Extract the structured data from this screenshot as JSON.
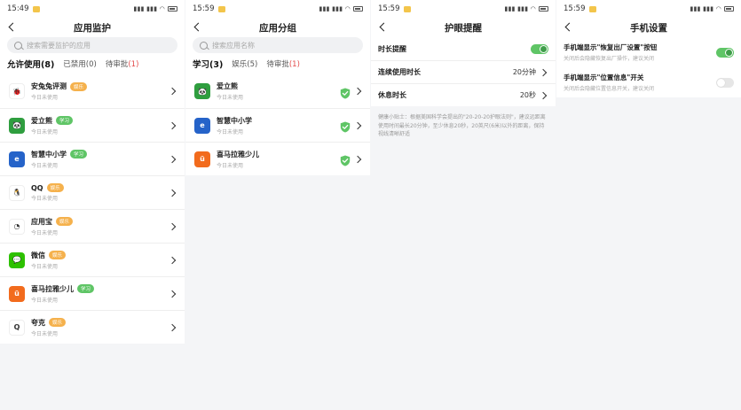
{
  "screens": [
    {
      "status_time": "15:49",
      "title": "应用监护",
      "search_placeholder": "搜索需要监护的应用",
      "tabs": [
        {
          "label": "允许使用(8)",
          "active": true
        },
        {
          "label": "已禁用(0)",
          "active": false
        },
        {
          "label": "待审批",
          "pending": "(1)",
          "active": false
        }
      ],
      "apps": [
        {
          "name": "安兔兔评测",
          "badge": "娱乐",
          "badge_color": "orange",
          "sub": "今日未使用",
          "icon": "antutu-icon",
          "icon_bg": "#ffffff",
          "glyph": "🐞"
        },
        {
          "name": "爱立熊",
          "badge": "学习",
          "badge_color": "green",
          "sub": "今日未使用",
          "icon": "panda-icon",
          "icon_bg": "#2f9e3f",
          "glyph": "🐼"
        },
        {
          "name": "智慧中小学",
          "badge": "学习",
          "badge_color": "green",
          "sub": "今日未使用",
          "icon": "edu-icon",
          "icon_bg": "#2563c9",
          "glyph": "e"
        },
        {
          "name": "QQ",
          "badge": "娱乐",
          "badge_color": "orange",
          "sub": "今日未使用",
          "icon": "qq-icon",
          "icon_bg": "#ffffff",
          "glyph": "🐧"
        },
        {
          "name": "应用宝",
          "badge": "娱乐",
          "badge_color": "orange",
          "sub": "今日未使用",
          "icon": "appstore-icon",
          "icon_bg": "#ffffff",
          "glyph": "◔"
        },
        {
          "name": "微信",
          "badge": "娱乐",
          "badge_color": "orange",
          "sub": "今日未使用",
          "icon": "wechat-icon",
          "icon_bg": "#2dc100",
          "glyph": "💬"
        },
        {
          "name": "喜马拉雅少儿",
          "badge": "学习",
          "badge_color": "green",
          "sub": "今日未使用",
          "icon": "ximalaya-icon",
          "icon_bg": "#f26b1d",
          "glyph": "ü"
        },
        {
          "name": "夸克",
          "badge": "娱乐",
          "badge_color": "orange",
          "sub": "今日未使用",
          "icon": "quark-icon",
          "icon_bg": "#ffffff",
          "glyph": "Q"
        }
      ]
    },
    {
      "status_time": "15:59",
      "title": "应用分组",
      "search_placeholder": "搜索应用名称",
      "tabs": [
        {
          "label": "学习(3)",
          "active": true
        },
        {
          "label": "娱乐(5)",
          "active": false
        },
        {
          "label": "待审批",
          "pending": "(1)",
          "active": false
        }
      ],
      "apps": [
        {
          "name": "爱立熊",
          "sub": "今日未使用",
          "icon": "panda-icon",
          "icon_bg": "#2f9e3f",
          "glyph": "🐼"
        },
        {
          "name": "智慧中小学",
          "sub": "今日未使用",
          "icon": "edu-icon",
          "icon_bg": "#2563c9",
          "glyph": "e"
        },
        {
          "name": "喜马拉雅少儿",
          "sub": "今日未使用",
          "icon": "ximalaya-icon",
          "icon_bg": "#f26b1d",
          "glyph": "ü"
        }
      ]
    },
    {
      "status_time": "15:59",
      "title": "护眼提醒",
      "settings": [
        {
          "label": "时长提醒",
          "type": "toggle",
          "on": true
        },
        {
          "label": "连续使用时长",
          "type": "value",
          "value": "20分钟"
        },
        {
          "label": "休息时长",
          "type": "value",
          "value": "20秒"
        }
      ],
      "tip": "健康小贴士：根据美国科学会提出的\"20-20-20护眼法则\"，建议远距离使用时间最长20分钟，至少休息20秒，20英尺(6米)以外的距离，保持视线清晰舒适"
    },
    {
      "status_time": "15:59",
      "title": "手机设置",
      "settings": [
        {
          "label": "手机端显示\"恢复出厂设置\"按钮",
          "sub": "关闭后会隐藏恢复出厂操作，建议关闭",
          "on": true
        },
        {
          "label": "手机端显示\"位置信息\"开关",
          "sub": "关闭后会隐藏位置信息开关，建议关闭",
          "on": false
        }
      ]
    }
  ],
  "colors": {
    "accent_green": "#5fc566",
    "badge_orange": "#f5b14c",
    "pending_red": "#e34b4b"
  }
}
